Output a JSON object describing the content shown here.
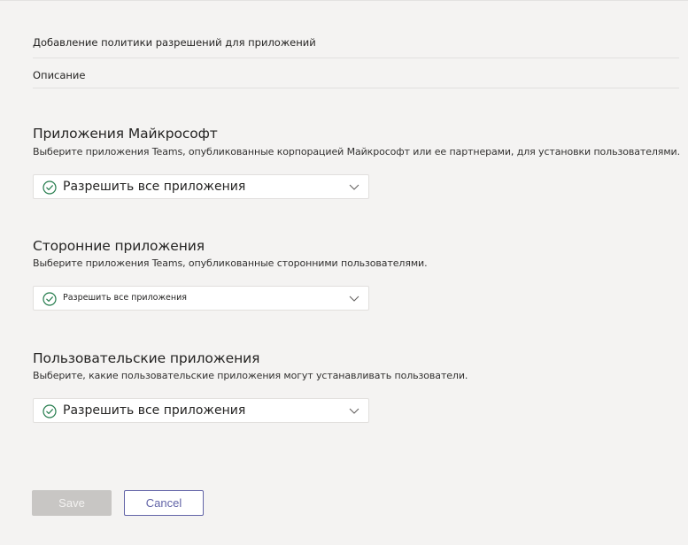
{
  "form": {
    "name_label": "Добавление политики разрешений для приложений",
    "description_label": "Описание"
  },
  "sections": [
    {
      "title": "Приложения Майкрософт",
      "description": "Выберите приложения Teams, опубликованные корпорацией Майкрософт или ее партнерами, для установки пользователями.",
      "selected_value": "Разрешить все приложения"
    },
    {
      "title": "Сторонние приложения",
      "description": "Выберите приложения Teams, опубликованные сторонними пользователями.",
      "selected_value": "Разрешить все приложения"
    },
    {
      "title": "Пользовательские приложения",
      "description": "Выберите, какие пользовательские приложения могут устанавливать пользователи.",
      "selected_value": "Разрешить все приложения"
    }
  ],
  "actions": {
    "save_label": "Save",
    "cancel_label": "Cancel"
  },
  "icons": {
    "check": "check-circle-icon",
    "chevron": "chevron-down-icon"
  },
  "colors": {
    "accent": "#6264a7",
    "check_green": "#237b4b",
    "background": "#f4f3f2",
    "save_disabled": "#c8c6c4"
  }
}
